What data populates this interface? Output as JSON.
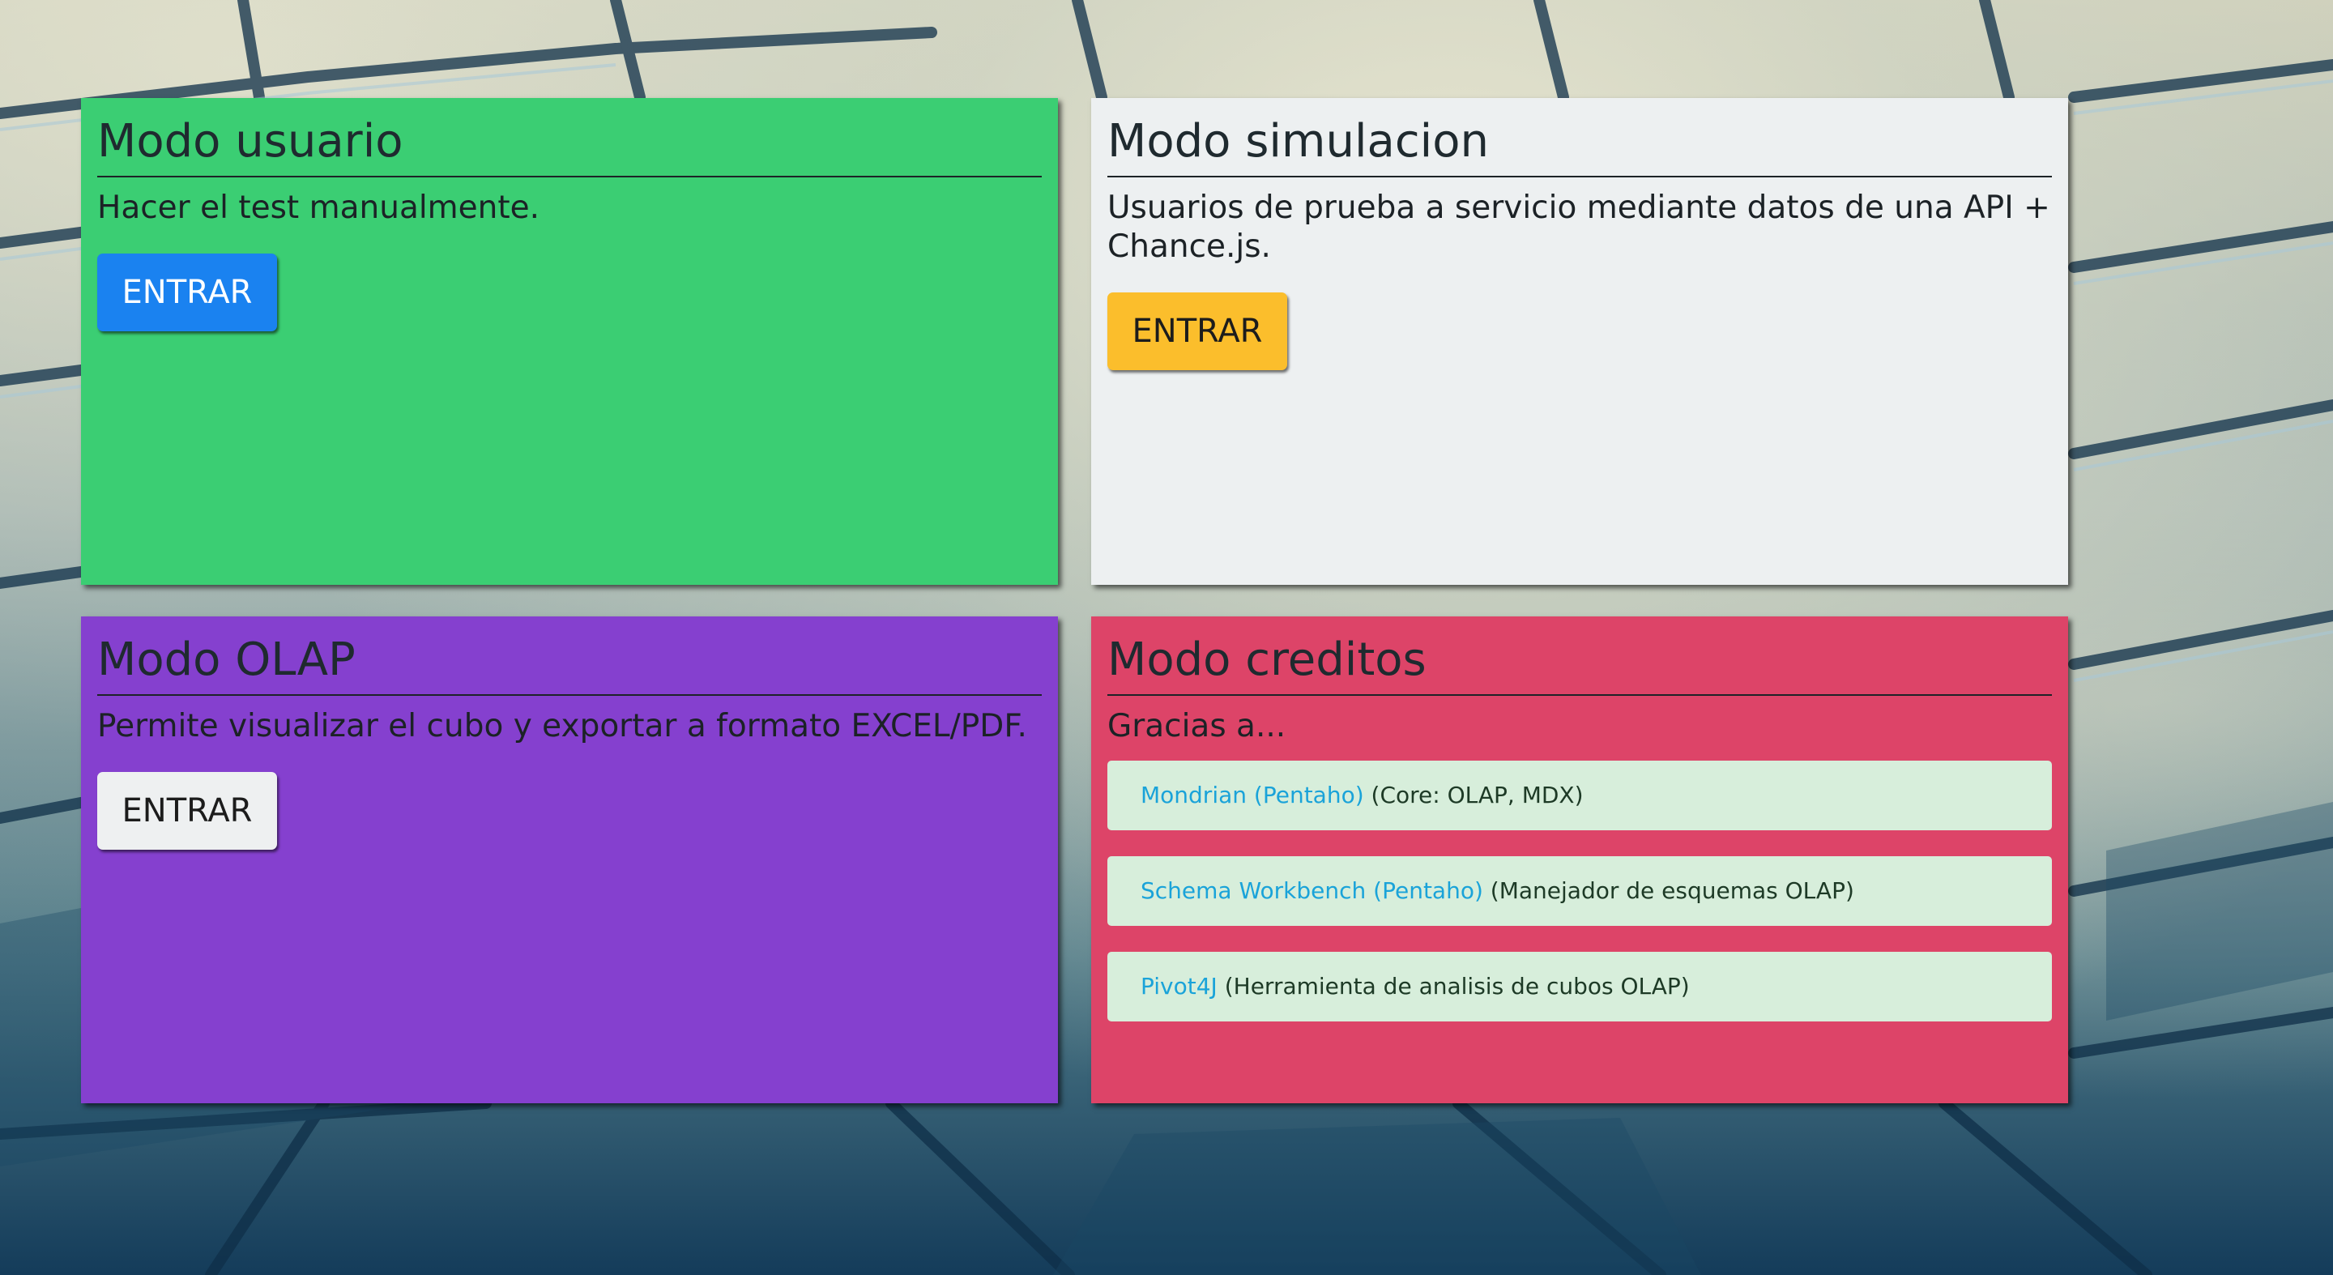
{
  "panels": {
    "usuario": {
      "title": "Modo usuario",
      "description": "Hacer el test manualmente.",
      "button_label": "ENTRAR",
      "background": "#3bce73",
      "button_color": "#1a82f0"
    },
    "simulacion": {
      "title": "Modo simulacion",
      "description": "Usuarios de prueba a servicio mediante datos de una API + Chance.js.",
      "button_label": "ENTRAR",
      "background": "#edf0f1",
      "button_color": "#fbbe2c"
    },
    "olap": {
      "title": "Modo OLAP",
      "description": "Permite visualizar el cubo y exportar a formato EXCEL/PDF.",
      "button_label": "ENTRAR",
      "background": "#8540cf",
      "button_color": "#eef0f1"
    },
    "creditos": {
      "title": "Modo creditos",
      "intro": "Gracias a...",
      "background": "#dd4468",
      "items": [
        {
          "link": "Mondrian (Pentaho)",
          "note": "(Core: OLAP, MDX)"
        },
        {
          "link": "Schema Workbench (Pentaho)",
          "note": "(Manejador de esquemas OLAP)"
        },
        {
          "link": "Pivot4J",
          "note": "(Herramienta de analisis de cubos OLAP)"
        }
      ]
    }
  },
  "colors": {
    "link": "#1aa3d9",
    "credit_item_bg": "#d7eedb"
  }
}
